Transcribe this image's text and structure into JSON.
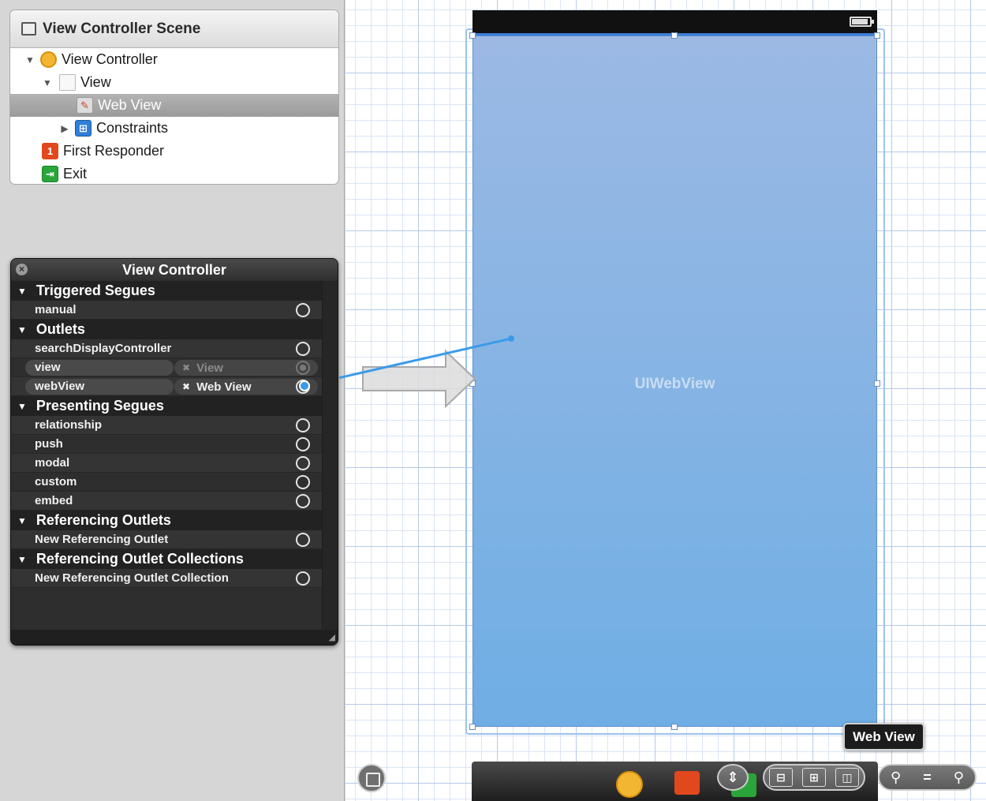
{
  "outline": {
    "scene_title": "View Controller Scene",
    "items": [
      {
        "label": "View Controller"
      },
      {
        "label": "View"
      },
      {
        "label": "Web View"
      },
      {
        "label": "Constraints"
      },
      {
        "label": "First Responder"
      },
      {
        "label": "Exit"
      }
    ]
  },
  "connections": {
    "title": "View Controller",
    "triggered_segues": {
      "title": "Triggered Segues",
      "items": [
        "manual"
      ]
    },
    "outlets": {
      "title": "Outlets",
      "items": [
        {
          "name": "searchDisplayController"
        },
        {
          "name": "view",
          "target": "View"
        },
        {
          "name": "webView",
          "target": "Web View"
        }
      ]
    },
    "presenting_segues": {
      "title": "Presenting Segues",
      "items": [
        "relationship",
        "push",
        "modal",
        "custom",
        "embed"
      ]
    },
    "referencing_outlets": {
      "title": "Referencing Outlets",
      "items": [
        "New Referencing Outlet"
      ]
    },
    "referencing_collections": {
      "title": "Referencing Outlet Collections",
      "items": [
        "New Referencing Outlet Collection"
      ]
    }
  },
  "canvas": {
    "webview_label": "UIWebView",
    "tooltip": "Web View"
  },
  "colors": {
    "webview_top": "#9cb9e4",
    "webview_bottom": "#6faee4",
    "connection_line": "#3a9be8",
    "hud_bg": "#2b2b2b"
  },
  "icons": [
    "scene-icon",
    "view-controller-icon",
    "view-icon",
    "web-view-icon",
    "constraints-icon",
    "first-responder-icon",
    "exit-icon",
    "close-icon",
    "battery-icon"
  ]
}
